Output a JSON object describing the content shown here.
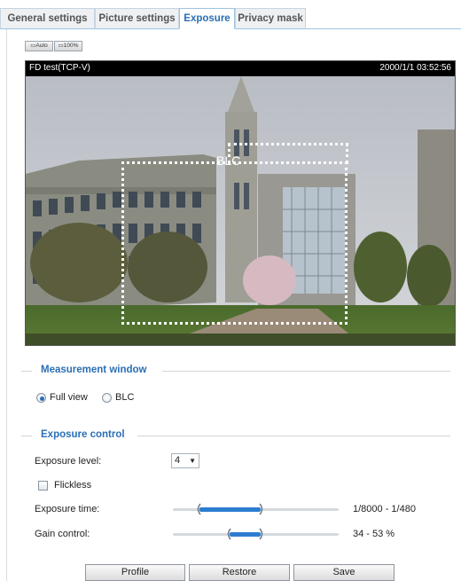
{
  "tabs": [
    {
      "label": "General settings",
      "active": false
    },
    {
      "label": "Picture settings",
      "active": false
    },
    {
      "label": "Exposure",
      "active": true
    },
    {
      "label": "Privacy mask",
      "active": false
    }
  ],
  "view_buttons": {
    "auto": "Auto",
    "full": "100%"
  },
  "video": {
    "title": "FD test(TCP-V)",
    "timestamp": "2000/1/1 03:52:56",
    "blc_label": "BLC"
  },
  "measurement": {
    "title": "Measurement window",
    "options": [
      {
        "label": "Full view",
        "selected": true
      },
      {
        "label": "BLC",
        "selected": false
      }
    ]
  },
  "exposure": {
    "title": "Exposure control",
    "level_label": "Exposure level:",
    "level_value": "4",
    "flickless_label": "Flickless",
    "flickless_checked": false,
    "time_label": "Exposure time:",
    "time_value": "1/8000 - 1/480",
    "time_range_fraction": [
      0.16,
      0.53
    ],
    "gain_label": "Gain control:",
    "gain_value": "34 - 53 %",
    "gain_range_fraction": [
      0.34,
      0.53
    ]
  },
  "buttons": {
    "profile": "Profile",
    "restore": "Restore",
    "save": "Save"
  },
  "colors": {
    "accent": "#2a6fb5",
    "slider": "#2d7ed0"
  }
}
